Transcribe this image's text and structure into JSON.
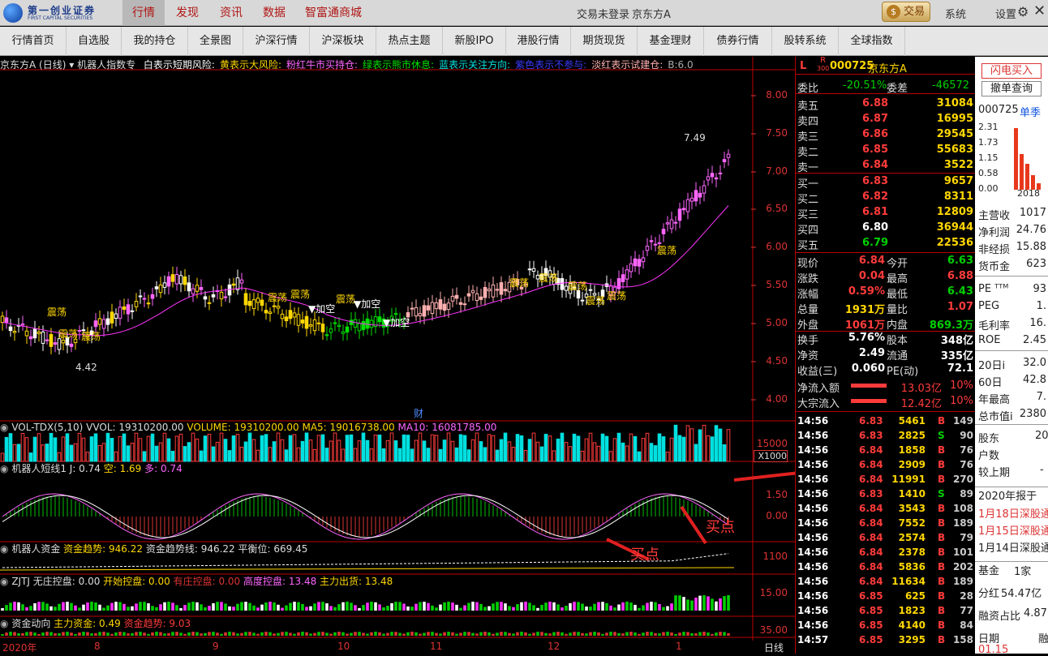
{
  "app": {
    "logo_cn": "第一创业证券",
    "logo_en": "FIRST CAPITAL SECURITIES"
  },
  "topnav": [
    "行情",
    "发现",
    "资讯",
    "数据",
    "智富通商城"
  ],
  "top_right": {
    "login": "交易未登录",
    "stock": "京东方A",
    "trade": "交易",
    "system": "系统",
    "settings": "设置"
  },
  "nav2": [
    "行情首页",
    "自选股",
    "我的持仓",
    "全景图",
    "沪深行情",
    "沪深板块",
    "热点主题",
    "新股IPO",
    "港股行情",
    "期货现货",
    "基金理财",
    "债券行情",
    "股转系统",
    "全球指数"
  ],
  "main": {
    "title": "京东方A (日线)",
    "indicator": "机器人指数专",
    "legend": [
      "白表示短期风险:",
      "黄表示大风险:",
      "粉红牛市买持仓:",
      "绿表示熊市休息:",
      "蓝表示关注方向:",
      "紫色表示不参与:",
      "淡红表示试建仓:",
      "B:6.0"
    ],
    "legend_colors": [
      "#ffffff",
      "#ffd700",
      "#ff66ff",
      "#00e000",
      "#00e0e0",
      "#3b3bff",
      "#ffb0b0",
      "#aaaaaa"
    ],
    "yticks": [
      "8.00",
      "7.50",
      "7.00",
      "6.50",
      "6.00",
      "5.50",
      "5.00",
      "4.50",
      "4.00"
    ],
    "high_label": "7.49",
    "low_label": "4.42",
    "annotations": [
      "震荡",
      "震荡",
      "震荡",
      "震荡",
      "震荡",
      "震荡",
      "震荡",
      "震荡",
      "震荡",
      "震荡",
      "震荡",
      "震荡"
    ],
    "add_labels": [
      "▼加空",
      "▼加空",
      "▼加空"
    ],
    "fin_marker": "财"
  },
  "vol": {
    "name": "VOL-TDX(5,10)",
    "vvol": "VVOL: 19310200.00",
    "volume": "VOLUME: 19310200.00",
    "ma5": "MA5: 19016738.00",
    "ma10": "MA10: 16081785.00",
    "ytick": "15000",
    "unit": "X1000"
  },
  "robot_short": {
    "name": "机器人短线1",
    "j": "J: 0.74",
    "kong": "空: 1.69",
    "duo": "多: 0.74",
    "yticks": [
      "1.50",
      "0.00"
    ],
    "sell": "卖点",
    "buy1": "买点",
    "buy2": "买点"
  },
  "robot_fund": {
    "name": "机器人资金",
    "trend": "资金趋势: 946.22",
    "trendline": "资金趋势线: 946.22",
    "balance": "平衡位: 669.45",
    "ytick": "1100"
  },
  "zjtj": {
    "name": "ZJTJ",
    "wu": "无庄控盘: 0.00",
    "kaishi": "开始控盘: 0.00",
    "youzhuang": "有庄控盘: 0.00",
    "gaodu": "高度控盘: 13.48",
    "chuhuo": "主力出货: 13.48",
    "ytick": "15.00"
  },
  "fundflow": {
    "name": "资金动向",
    "main": "主力资金: 0.49",
    "trend": "资金趋势: 9.03",
    "ytick": "35.00"
  },
  "dates": [
    "2020年",
    "8",
    "9",
    "10",
    "11",
    "12",
    "1"
  ],
  "period": "日线",
  "quote": {
    "header_code": "000725",
    "header_name": "京东方A",
    "l": "L",
    "r": "R",
    "r_sub": "300",
    "weibi_label": "委比",
    "weibi": "-20.51%",
    "weicha_label": "委差",
    "weicha": "-46572",
    "asks": [
      {
        "label": "卖五",
        "price": "6.88",
        "vol": "31084"
      },
      {
        "label": "卖四",
        "price": "6.87",
        "vol": "16995"
      },
      {
        "label": "卖三",
        "price": "6.86",
        "vol": "29545"
      },
      {
        "label": "卖二",
        "price": "6.85",
        "vol": "55683"
      },
      {
        "label": "卖一",
        "price": "6.84",
        "vol": "3522"
      }
    ],
    "bids": [
      {
        "label": "买一",
        "price": "6.83",
        "vol": "9657"
      },
      {
        "label": "买二",
        "price": "6.82",
        "vol": "8311"
      },
      {
        "label": "买三",
        "price": "6.81",
        "vol": "12809"
      },
      {
        "label": "买四",
        "price": "6.80",
        "vol": "36944"
      },
      {
        "label": "买五",
        "price": "6.79",
        "vol": "22536"
      }
    ],
    "stats": [
      {
        "l1": "现价",
        "v1": "6.84",
        "l2": "今开",
        "v2": "6.63",
        "c1": "red",
        "c2": "grn"
      },
      {
        "l1": "涨跌",
        "v1": "0.04",
        "l2": "最高",
        "v2": "6.88",
        "c1": "red",
        "c2": "red"
      },
      {
        "l1": "涨幅",
        "v1": "0.59%",
        "l2": "最低",
        "v2": "6.43",
        "c1": "red",
        "c2": "grn"
      },
      {
        "l1": "总量",
        "v1": "1931万",
        "l2": "量比",
        "v2": "1.07",
        "c1": "yel",
        "c2": "red"
      },
      {
        "l1": "外盘",
        "v1": "1061万",
        "l2": "内盘",
        "v2": "869.3万",
        "c1": "red",
        "c2": "grn"
      },
      {
        "l1": "换手",
        "v1": "5.76%",
        "l2": "股本",
        "v2": "348亿",
        "c1": "wht",
        "c2": "wht"
      },
      {
        "l1": "净资",
        "v1": "2.49",
        "l2": "流通",
        "v2": "335亿",
        "c1": "wht",
        "c2": "wht"
      },
      {
        "l1": "收益(三)",
        "v1": "0.060",
        "l2": "PE(动)",
        "v2": "72.1",
        "c1": "wht",
        "c2": "wht"
      }
    ],
    "inflow": [
      {
        "label": "净流入额",
        "val": "13.03亿",
        "pct": "10%"
      },
      {
        "label": "大宗流入",
        "val": "12.42亿",
        "pct": "10%"
      }
    ],
    "ticks": [
      {
        "t": "14:56",
        "p": "6.83",
        "v": "5461",
        "s": "B",
        "n": "149"
      },
      {
        "t": "14:56",
        "p": "6.83",
        "v": "2825",
        "s": "S",
        "n": "90"
      },
      {
        "t": "14:56",
        "p": "6.84",
        "v": "1858",
        "s": "B",
        "n": "76"
      },
      {
        "t": "14:56",
        "p": "6.84",
        "v": "2909",
        "s": "B",
        "n": "76"
      },
      {
        "t": "14:56",
        "p": "6.84",
        "v": "11991",
        "s": "B",
        "n": "270"
      },
      {
        "t": "14:56",
        "p": "6.83",
        "v": "1410",
        "s": "S",
        "n": "89"
      },
      {
        "t": "14:56",
        "p": "6.84",
        "v": "3543",
        "s": "B",
        "n": "108"
      },
      {
        "t": "14:56",
        "p": "6.84",
        "v": "7552",
        "s": "B",
        "n": "189"
      },
      {
        "t": "14:56",
        "p": "6.84",
        "v": "2574",
        "s": "B",
        "n": "79"
      },
      {
        "t": "14:56",
        "p": "6.84",
        "v": "2378",
        "s": "B",
        "n": "101"
      },
      {
        "t": "14:56",
        "p": "6.84",
        "v": "5836",
        "s": "B",
        "n": "202"
      },
      {
        "t": "14:56",
        "p": "6.84",
        "v": "11634",
        "s": "B",
        "n": "189"
      },
      {
        "t": "14:56",
        "p": "6.85",
        "v": "625",
        "s": "B",
        "n": "28"
      },
      {
        "t": "14:56",
        "p": "6.85",
        "v": "1823",
        "s": "B",
        "n": "77"
      },
      {
        "t": "14:56",
        "p": "6.85",
        "v": "4140",
        "s": "B",
        "n": "84"
      },
      {
        "t": "14:57",
        "p": "6.85",
        "v": "3295",
        "s": "B",
        "n": "158"
      }
    ]
  },
  "far": {
    "btn1": "闪电买入",
    "btn2": "撤单查询",
    "code": "000725",
    "dan": "单季",
    "bar_yticks": [
      "2.31",
      "1.73",
      "1.15",
      "0.58",
      "0.00"
    ],
    "year": "2018",
    "items": [
      {
        "l": "主营收",
        "v": "1017"
      },
      {
        "l": "净利润",
        "v": "24.76"
      },
      {
        "l": "非经损",
        "v": "15.88"
      },
      {
        "l": "货币金",
        "v": "623"
      },
      {
        "l": "PE ᵀᵀᴹ",
        "v": "93"
      },
      {
        "l": "PEG",
        "v": "1."
      },
      {
        "l": "毛利率",
        "v": "16."
      },
      {
        "l": "ROE",
        "v": "2.45"
      },
      {
        "l": "20日i",
        "v": "32.0"
      },
      {
        "l": "60日",
        "v": "42.8"
      },
      {
        "l": "年最高",
        "v": "7."
      },
      {
        "l": "总市值i",
        "v": "2380"
      }
    ],
    "gudong": "股东",
    "gudong_v": "20",
    "hushu": "户数",
    "jiaoshang": "较上期",
    "jiaoshang_v": "-",
    "report": "2020年报于",
    "notice1": "1月18日深股通",
    "notice2": "1月15日深股通",
    "notice3": "1月14日深股通",
    "fund": "基金",
    "fund_v": "1家",
    "fenhong": "分红",
    "fenhong_v": "54.47亿",
    "rongzi": "融资占比",
    "rongzi_v": "4.87",
    "riqi": "日期",
    "rongzi2": "融",
    "date_v": "01.15"
  }
}
